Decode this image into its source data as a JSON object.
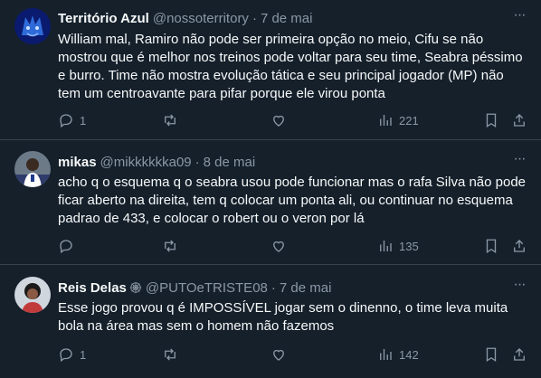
{
  "tweets": [
    {
      "name": "Território Azul",
      "handle": "@nossoterritory",
      "separator": "·",
      "time": "7 de mai",
      "text": "William mal, Ramiro não pode ser primeira opção no meio, Cifu se não mostrou que é melhor nos treinos pode voltar para seu time, Seabra péssimo e burro. Time não mostra evolução tática e seu principal jogador (MP) não tem um centroavante para pifar porque ele virou ponta",
      "replies": "1",
      "retweets": "",
      "likes": "",
      "views": "221",
      "avatar": "blue-wolf-avatar"
    },
    {
      "name": "mikas",
      "handle": "@mikkkkkka09",
      "separator": "·",
      "time": "8 de mai",
      "text": "acho q o esquema q o seabra usou pode funcionar mas o rafa Silva não pode ficar aberto na direita, tem q colocar um ponta ali, ou continuar no esquema padrao de 433, e colocar o robert ou o veron por lá",
      "replies": "",
      "retweets": "",
      "likes": "",
      "views": "135",
      "avatar": "player-photo-avatar"
    },
    {
      "name": "Reis Delas",
      "handle": "@PUTOeTRISTE08",
      "separator": "·",
      "time": "7 de mai",
      "text": "Esse jogo provou q é IMPOSSÍVEL jogar sem o dinenno, o time leva muita bola na área mas sem o homem não fazemos",
      "replies": "1",
      "retweets": "",
      "likes": "",
      "views": "142",
      "avatar": "person-photo-avatar",
      "badge": "spider-web-icon"
    }
  ],
  "more_label": "···",
  "colors": {
    "background": "#15202b",
    "text": "#f7f9f9",
    "secondary": "#8b98a5",
    "border": "#38444d"
  }
}
